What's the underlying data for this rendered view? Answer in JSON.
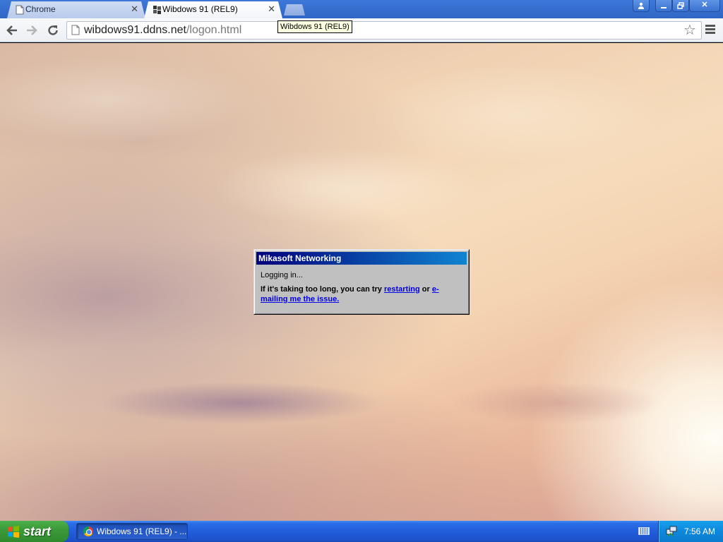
{
  "browser": {
    "tabs": [
      {
        "label": "Chrome",
        "active": false,
        "icon": "page-icon"
      },
      {
        "label": "Wibdows 91 (REL9)",
        "active": true,
        "icon": "wibdows-logo-icon"
      }
    ],
    "tooltip": "Wibdows 91 (REL9)",
    "url": {
      "host": "wibdows91.ddns.net",
      "path": "/logon.html"
    }
  },
  "dialog": {
    "title": "Mikasoft Networking",
    "status": "Logging in...",
    "message_prefix": "If it's taking too long, you can try ",
    "link_restart": "restarting",
    "message_mid": " or ",
    "link_email": "e-mailing me the issue."
  },
  "taskbar": {
    "start_label": "start",
    "task_label": "Wibdows 91 (REL9) - ...",
    "clock": "7:56 AM"
  },
  "colors": {
    "titlebar_blue": "#3d78d8",
    "dialog_title_start": "#00007b",
    "dialog_title_end": "#1084d0",
    "taskbar_blue": "#225edb",
    "start_green": "#3c9a3a",
    "link_blue": "#0000ee"
  }
}
